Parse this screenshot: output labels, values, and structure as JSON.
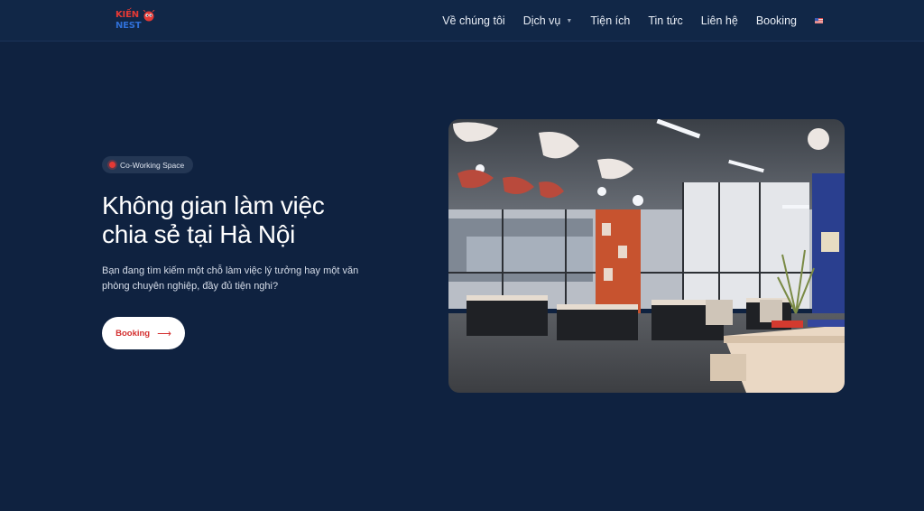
{
  "header": {
    "logo_line1": "KIẾN",
    "logo_line2": "NEST",
    "nav": [
      {
        "label": "Về chúng tôi"
      },
      {
        "label": "Dịch vụ",
        "has_dropdown": true
      },
      {
        "label": "Tiện ích"
      },
      {
        "label": "Tin tức"
      },
      {
        "label": "Liên hệ"
      },
      {
        "label": "Booking"
      }
    ],
    "language_icon": "us-flag-icon"
  },
  "hero": {
    "badge": "Co-Working Space",
    "title_line1": "Không gian làm việc",
    "title_line2": "chia sẻ tại Hà Nội",
    "description": "Bạn đang tìm kiếm một chỗ làm việc lý tưởng hay một văn phòng chuyên nghiệp, đầy đủ tiện nghi?",
    "cta_label": "Booking",
    "cta_icon": "arrow-right-icon",
    "image_icon": "coworking-interior-photo"
  },
  "colors": {
    "background": "#0f2240",
    "header": "#112747",
    "accent_red": "#e53935",
    "brand_blue": "#2f6fd6"
  }
}
